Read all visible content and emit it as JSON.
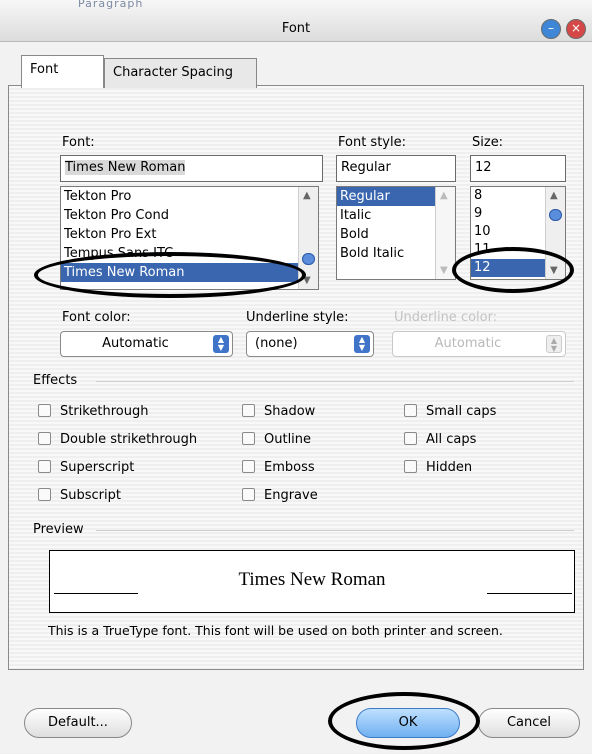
{
  "titlebar": {
    "title": "Font",
    "behind_text": "Paragraph"
  },
  "tabs": [
    {
      "label": "Font",
      "active": true
    },
    {
      "label": "Character Spacing",
      "active": false
    }
  ],
  "font": {
    "label": "Font:",
    "value": "Times New Roman",
    "items": [
      "Tekton Pro",
      "Tekton Pro Cond",
      "Tekton Pro Ext",
      "Tempus Sans ITC",
      "Times New Roman"
    ],
    "selected": "Times New Roman"
  },
  "font_style": {
    "label": "Font style:",
    "value": "Regular",
    "items": [
      "Regular",
      "Italic",
      "Bold",
      "Bold Italic"
    ],
    "selected": "Regular"
  },
  "size": {
    "label": "Size:",
    "value": "12",
    "items": [
      "8",
      "9",
      "10",
      "11",
      "12"
    ],
    "selected": "12"
  },
  "font_color": {
    "label": "Font color:",
    "value": "Automatic"
  },
  "underline_style": {
    "label": "Underline style:",
    "value": "(none)"
  },
  "underline_color": {
    "label": "Underline color:",
    "value": "Automatic"
  },
  "effects": {
    "label": "Effects",
    "col1": [
      "Strikethrough",
      "Double strikethrough",
      "Superscript",
      "Subscript"
    ],
    "col2": [
      "Shadow",
      "Outline",
      "Emboss",
      "Engrave"
    ],
    "col3": [
      "Small caps",
      "All caps",
      "Hidden"
    ]
  },
  "preview": {
    "label": "Preview",
    "sample": "Times New Roman",
    "note": "This is a TrueType font. This font will be used on both printer and screen."
  },
  "buttons": {
    "default": "Default...",
    "ok": "OK",
    "cancel": "Cancel"
  },
  "colors": {
    "selection": "#3a66b0",
    "ok_button": "#6fb0f0",
    "annotation": "#000000"
  }
}
